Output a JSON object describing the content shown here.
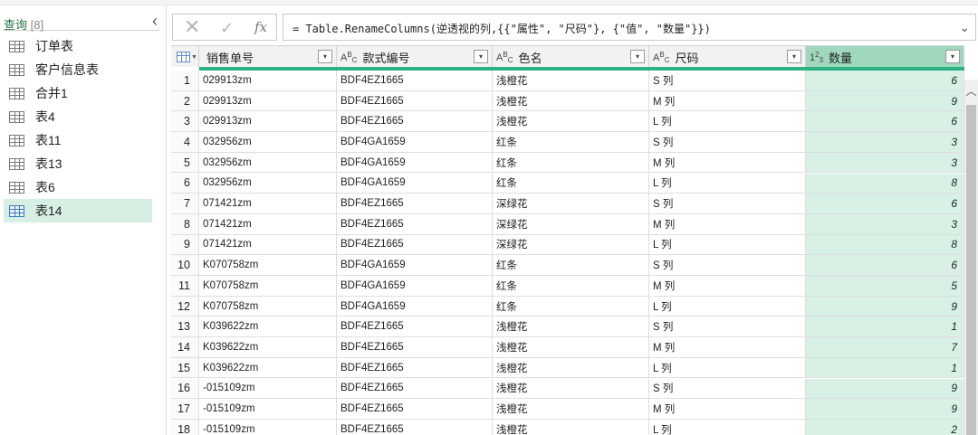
{
  "queries": {
    "title": "查询",
    "count": "[8]",
    "collapse_glyph": "‹",
    "items": [
      {
        "label": "订单表",
        "selected": false
      },
      {
        "label": "客户信息表",
        "selected": false
      },
      {
        "label": "合并1",
        "selected": false
      },
      {
        "label": "表4",
        "selected": false
      },
      {
        "label": "表11",
        "selected": false
      },
      {
        "label": "表13",
        "selected": false
      },
      {
        "label": "表6",
        "selected": false
      },
      {
        "label": "表14",
        "selected": true
      }
    ]
  },
  "formula_bar": {
    "cancel_glyph": "✕",
    "confirm_glyph": "✓",
    "fx_label": "fx",
    "formula": "= Table.RenameColumns(逆透视的列,{{\"属性\", \"尺码\"}, {\"值\", \"数量\"}})",
    "expand_glyph": "⌄"
  },
  "grid": {
    "columns": [
      {
        "label": "销售单号",
        "type": "any",
        "type_parts": [
          "",
          "",
          ""
        ]
      },
      {
        "label": "款式编号",
        "type": "text",
        "type_parts": [
          "A",
          "B",
          "C"
        ]
      },
      {
        "label": "色名",
        "type": "text",
        "type_parts": [
          "A",
          "B",
          "C"
        ]
      },
      {
        "label": "尺码",
        "type": "text",
        "type_parts": [
          "A",
          "B",
          "C"
        ]
      },
      {
        "label": "数量",
        "type": "number",
        "type_parts": [
          "1",
          "2",
          "3"
        ]
      }
    ],
    "filter_glyph": "▾",
    "rows": [
      {
        "idx": "1",
        "order": "029913zm",
        "style": "BDF4EZ1665",
        "color": "浅橙花",
        "size": "S 列",
        "qty": "6"
      },
      {
        "idx": "2",
        "order": "029913zm",
        "style": "BDF4EZ1665",
        "color": "浅橙花",
        "size": "M 列",
        "qty": "9"
      },
      {
        "idx": "3",
        "order": "029913zm",
        "style": "BDF4EZ1665",
        "color": "浅橙花",
        "size": "L 列",
        "qty": "6"
      },
      {
        "idx": "4",
        "order": "032956zm",
        "style": "BDF4GA1659",
        "color": "红条",
        "size": "S 列",
        "qty": "3"
      },
      {
        "idx": "5",
        "order": "032956zm",
        "style": "BDF4GA1659",
        "color": "红条",
        "size": "M 列",
        "qty": "3"
      },
      {
        "idx": "6",
        "order": "032956zm",
        "style": "BDF4GA1659",
        "color": "红条",
        "size": "L 列",
        "qty": "8"
      },
      {
        "idx": "7",
        "order": "071421zm",
        "style": "BDF4EZ1665",
        "color": "深绿花",
        "size": "S 列",
        "qty": "6"
      },
      {
        "idx": "8",
        "order": "071421zm",
        "style": "BDF4EZ1665",
        "color": "深绿花",
        "size": "M 列",
        "qty": "3"
      },
      {
        "idx": "9",
        "order": "071421zm",
        "style": "BDF4EZ1665",
        "color": "深绿花",
        "size": "L 列",
        "qty": "8"
      },
      {
        "idx": "10",
        "order": "K070758zm",
        "style": "BDF4GA1659",
        "color": "红条",
        "size": "S 列",
        "qty": "6"
      },
      {
        "idx": "11",
        "order": "K070758zm",
        "style": "BDF4GA1659",
        "color": "红条",
        "size": "M 列",
        "qty": "5"
      },
      {
        "idx": "12",
        "order": "K070758zm",
        "style": "BDF4GA1659",
        "color": "红条",
        "size": "L 列",
        "qty": "9"
      },
      {
        "idx": "13",
        "order": "K039622zm",
        "style": "BDF4EZ1665",
        "color": "浅橙花",
        "size": "S 列",
        "qty": "1"
      },
      {
        "idx": "14",
        "order": "K039622zm",
        "style": "BDF4EZ1665",
        "color": "浅橙花",
        "size": "M 列",
        "qty": "7"
      },
      {
        "idx": "15",
        "order": "K039622zm",
        "style": "BDF4EZ1665",
        "color": "浅橙花",
        "size": "L 列",
        "qty": "1"
      },
      {
        "idx": "16",
        "order": "-015109zm",
        "style": "BDF4EZ1665",
        "color": "浅橙花",
        "size": "S 列",
        "qty": "9"
      },
      {
        "idx": "17",
        "order": "-015109zm",
        "style": "BDF4EZ1665",
        "color": "浅橙花",
        "size": "M 列",
        "qty": "9"
      },
      {
        "idx": "18",
        "order": "-015109zm",
        "style": "BDF4EZ1665",
        "color": "浅橙花",
        "size": "L 列",
        "qty": "2"
      }
    ]
  },
  "scrollbar": {
    "up_glyph": "︿"
  },
  "colors": {
    "accent": "#217346",
    "column_accent": "#2db184",
    "selected_bg": "#d7efe2",
    "number_col_bg": "#d9f0e4"
  }
}
